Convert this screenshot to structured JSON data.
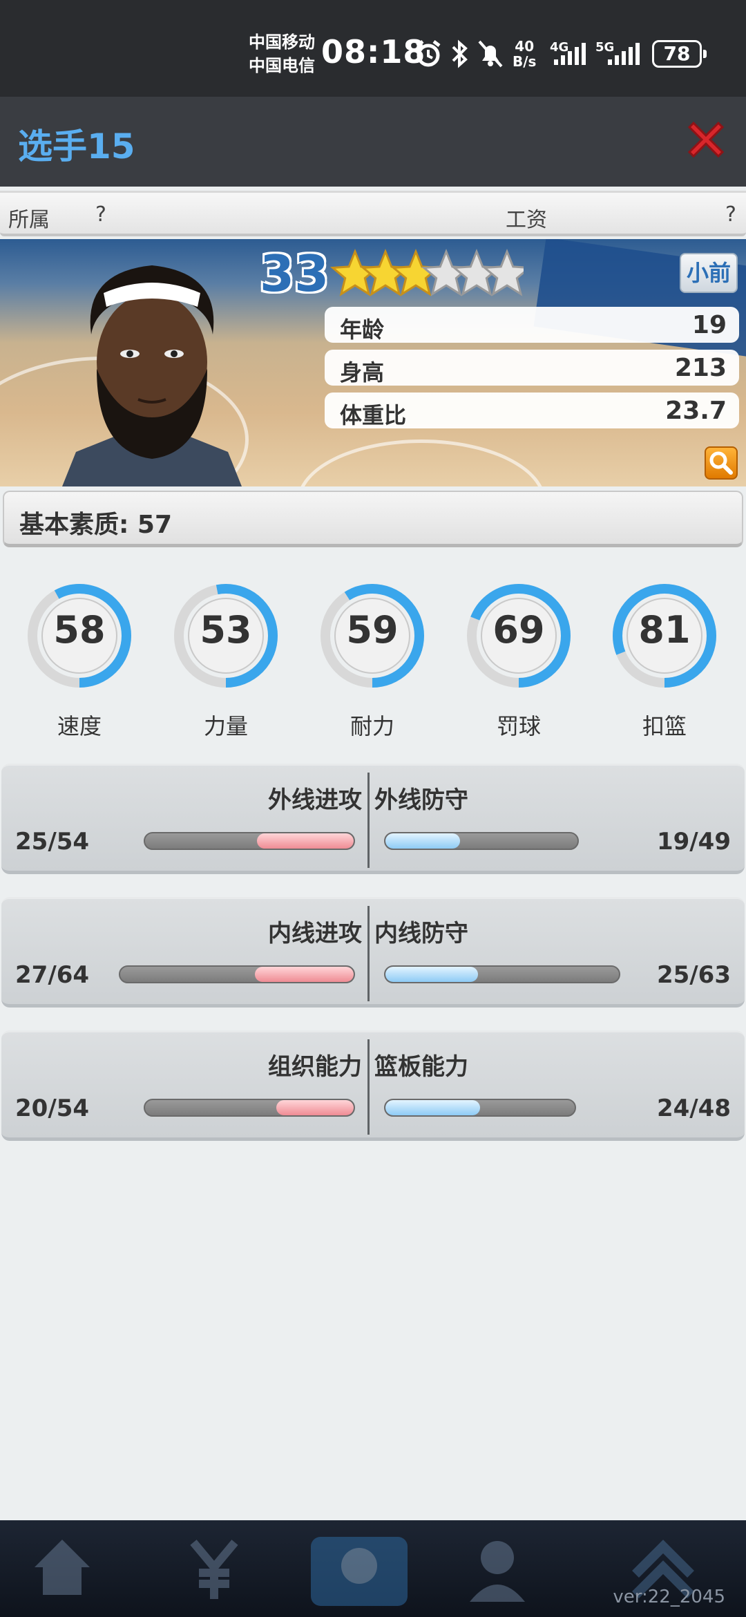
{
  "status_bar": {
    "carrier1": "中国移动",
    "carrier2": "中国电信",
    "time": "08:18",
    "net_speed_value": "40",
    "net_speed_unit": "B/s",
    "signal1_label": "4G",
    "signal2_label": "5G",
    "battery": "78",
    "icons": [
      "alarm-icon",
      "bluetooth-icon",
      "mute-icon"
    ]
  },
  "dialog": {
    "title": "选手15",
    "close_icon": "close-x-icon"
  },
  "info_bar": {
    "owner_label": "所属",
    "owner_value": "?",
    "salary_label": "工资",
    "salary_value": "?"
  },
  "player": {
    "overall": "33",
    "stars_filled": 3,
    "stars_total": 6,
    "position": "小前",
    "attributes": [
      {
        "label": "年龄",
        "value": "19"
      },
      {
        "label": "身高",
        "value": "213"
      },
      {
        "label": "体重比",
        "value": "23.7"
      }
    ]
  },
  "basic_quality": "基本素质: 57",
  "skills": [
    {
      "label": "速度",
      "value": "58"
    },
    {
      "label": "力量",
      "value": "53"
    },
    {
      "label": "耐力",
      "value": "59"
    },
    {
      "label": "罚球",
      "value": "69"
    },
    {
      "label": "扣篮",
      "value": "81"
    }
  ],
  "comparisons": [
    {
      "left_title": "外线进攻",
      "left_value": "25/54",
      "right_title": "外线防守",
      "right_value": "19/49",
      "left_current": 25,
      "left_max": 54,
      "right_current": 19,
      "right_max": 49
    },
    {
      "left_title": "内线进攻",
      "left_value": "27/64",
      "right_title": "内线防守",
      "right_value": "25/63",
      "left_current": 27,
      "left_max": 64,
      "right_current": 25,
      "right_max": 63
    },
    {
      "left_title": "组织能力",
      "left_value": "20/54",
      "right_title": "篮板能力",
      "right_value": "24/48",
      "left_current": 20,
      "left_max": 54,
      "right_current": 24,
      "right_max": 48
    }
  ],
  "footer": {
    "version": "ver:22_2045"
  },
  "colors": {
    "title_blue": "#5aaef0",
    "ring_blue": "#3aa6ec",
    "ring_grey": "#d8d8d8",
    "bar_red": "#ef8c94",
    "bar_blue": "#8ecbf5"
  }
}
